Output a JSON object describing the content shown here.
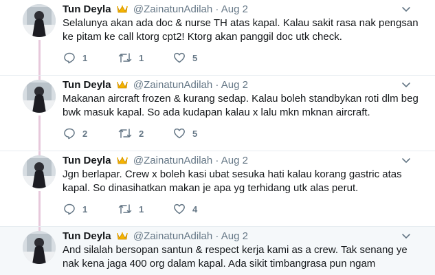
{
  "tweets": [
    {
      "name": "Tun Deyla",
      "handle": "@ZainatunAdilah",
      "separator": "·",
      "date": "Aug 2",
      "text": "Selalunya akan ada doc & nurse TH atas kapal. Kalau sakit rasa nak pengsan ke pitam ke call ktorg cpt2! Ktorg akan panggil doc utk check.",
      "replies": "1",
      "retweets": "1",
      "likes": "5",
      "highlighted": false
    },
    {
      "name": "Tun Deyla",
      "handle": "@ZainatunAdilah",
      "separator": "·",
      "date": "Aug 2",
      "text": "Makanan aircraft frozen & kurang sedap. Kalau boleh standbykan roti dlm beg bwk masuk kapal. So ada kudapan kalau x lalu mkn mknan aircraft.",
      "replies": "2",
      "retweets": "2",
      "likes": "5",
      "highlighted": false
    },
    {
      "name": "Tun Deyla",
      "handle": "@ZainatunAdilah",
      "separator": "·",
      "date": "Aug 2",
      "text": "Jgn berlapar. Crew x boleh kasi ubat sesuka hati kalau korang gastric atas kapal. So dinasihatkan makan je apa yg terhidang utk alas perut.",
      "replies": "1",
      "retweets": "1",
      "likes": "4",
      "highlighted": false
    },
    {
      "name": "Tun Deyla",
      "handle": "@ZainatunAdilah",
      "separator": "·",
      "date": "Aug 2",
      "text": "And silalah bersopan santun & respect kerja kami as a crew. Tak senang ye nak kena jaga 400 org dalam kapal. Ada sikit timbangrasa pun ngam",
      "replies": "",
      "retweets": "",
      "likes": "",
      "highlighted": true
    }
  ],
  "colors": {
    "thread_line": "#e7c8db",
    "meta_gray": "#657786",
    "highlight_bg": "#f5f8fa"
  },
  "icons": {
    "reply": "reply-icon",
    "retweet": "retweet-icon",
    "like": "heart-icon",
    "badge": "crown-emoji-icon",
    "caret": "chevron-down-icon"
  }
}
